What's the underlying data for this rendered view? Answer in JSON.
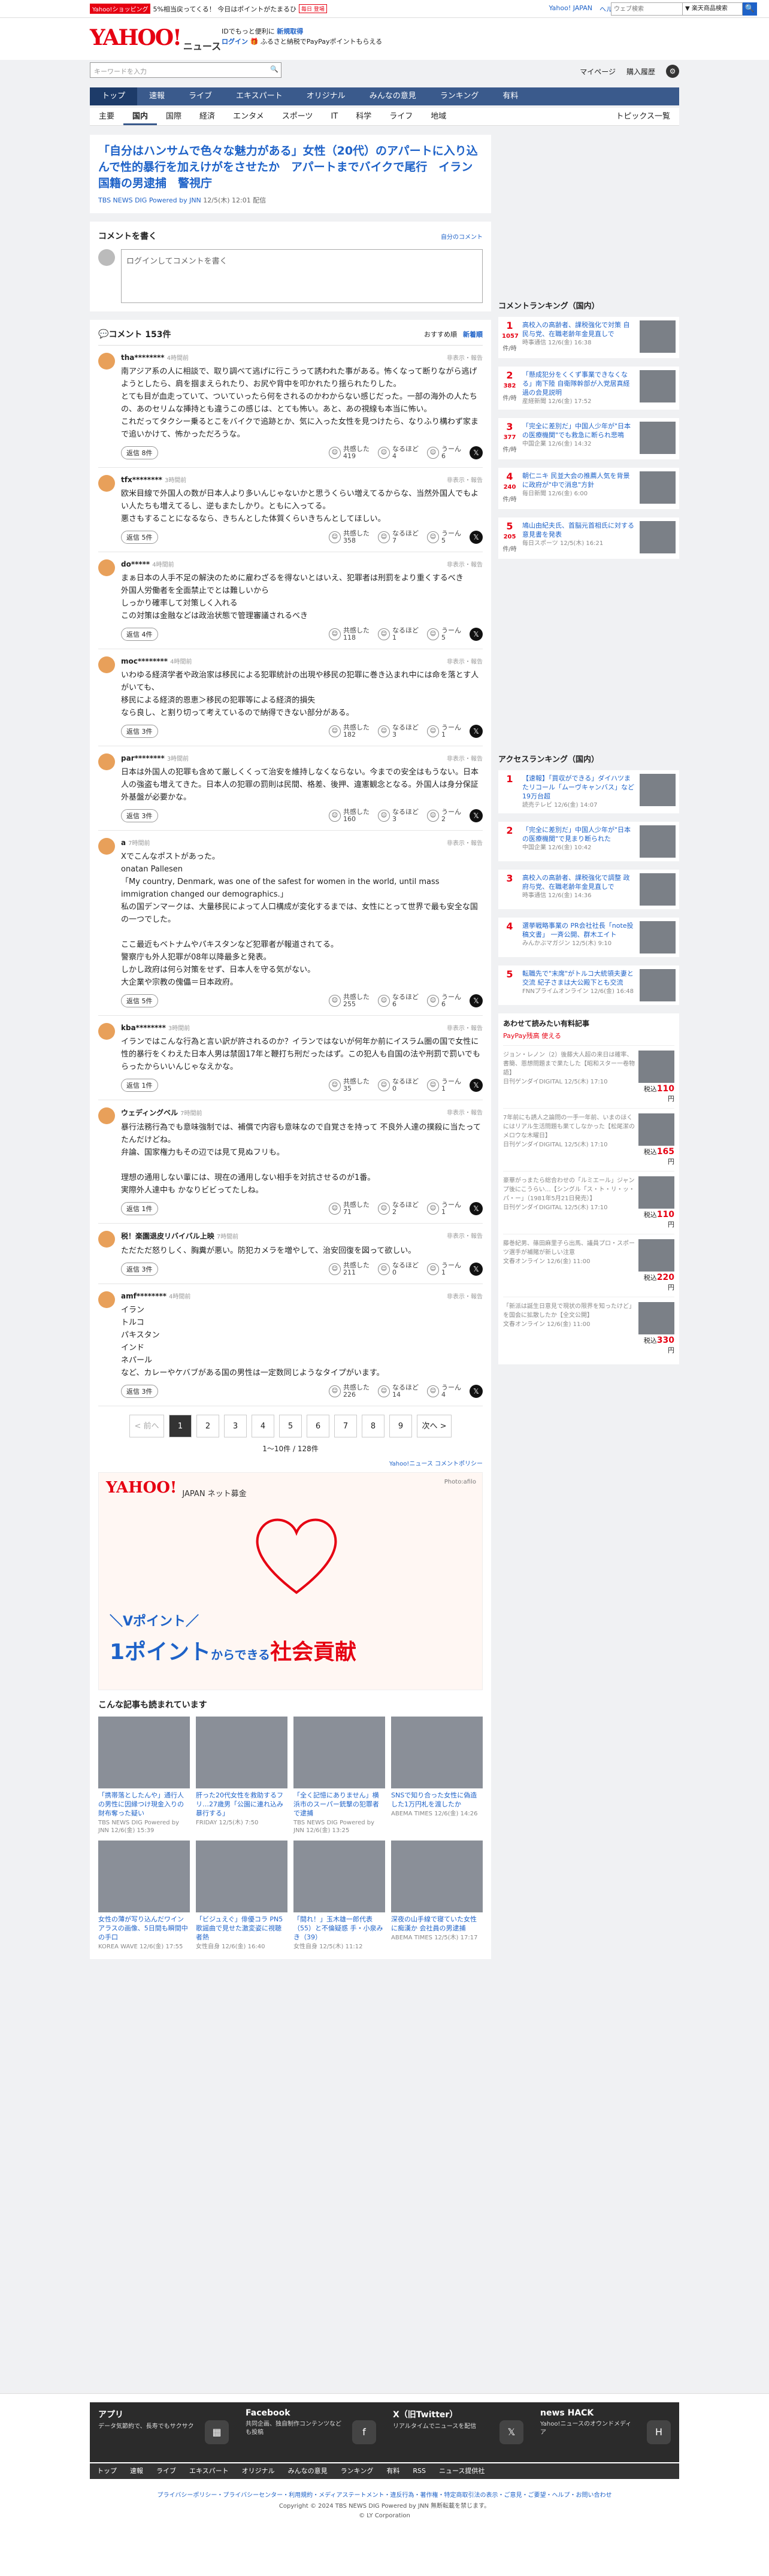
{
  "topbar": {
    "promo_tag": "Yahoo!ショッピング",
    "promo_text": "5%相当戻ってくる！ 今日はポイントがたまるひ",
    "promo_pill": "毎日 登場",
    "links": [
      "Yahoo! JAPAN",
      "ヘルプ"
    ],
    "search_placeholder": "ウェブ検索",
    "search_select": "▼ 楽天商品検索",
    "search_button": "🔍"
  },
  "header": {
    "logo": "YAHOO!",
    "logo_sub": "ニュース",
    "note1_prefix": "IDでもっと便利に",
    "note1_link": "新規取得",
    "note2_login": "ログイン",
    "note2_text": "ふるさと納税でPayPayポイントもらえる",
    "search_placeholder": "キーワードを入力",
    "right_links": [
      "マイページ",
      "購入履歴"
    ],
    "gear": "⚙"
  },
  "nav": {
    "main": [
      "トップ",
      "速報",
      "ライブ",
      "エキスパート",
      "オリジナル",
      "みんなの意見",
      "ランキング",
      "有料"
    ],
    "active": 0,
    "sub": [
      "主要",
      "国内",
      "国際",
      "経済",
      "エンタメ",
      "スポーツ",
      "IT",
      "科学",
      "ライフ",
      "地域"
    ],
    "sub_active": 1,
    "sub_right": "トピックス一覧"
  },
  "article": {
    "headline": "「自分はハンサムで色々な魅力がある」女性（20代）のアパートに入り込んで性的暴行を加えけがをさせたか　アパートまでバイクで尾行　イラン国籍の男逮捕　警視庁",
    "source": "TBS NEWS DIG Powered by JNN",
    "date": "12/5(木) 12:01 配信"
  },
  "comment_form": {
    "title": "コメントを書く",
    "right": "自分のコメント",
    "placeholder": "ログインしてコメントを書く"
  },
  "comments_head": {
    "title": "コメント 153件",
    "sort": [
      "おすすめ順",
      "新着順"
    ]
  },
  "comments": [
    {
      "user": "tha********",
      "time": "4時間前",
      "text": "南アジア系の人に相談で、取り調べて逃げに行こうって誘われた事がある。怖くなって断りながら逃げようとしたら、肩を掴まえられたり、お尻や背中を叩かれたり揺られたりした。\nとても目が血走っていて、ついていったら何をされるのかわからない感じだった。一部の海外の人たちの、あのセリムな挿持とも違うこの感じは、とても怖い。あと、あの視線も本当に怖い。\nこれだってタクシー乗るとこをバイクで追跡とか、気に入った女性を見つけたら、なりふり構わず家まで追いかけて、怖かっただろうな。",
      "reply": "返信 8件",
      "v1": "419",
      "v2": "4",
      "v3": "6"
    },
    {
      "user": "tfx********",
      "time": "3時間前",
      "text": "欧米目線で外国人の数が日本人より多いんじゃないかと思うくらい増えてるからな、当然外国人でもよい人たちも増えてるし、逆もまたしかり。ともに入ってる。\n悪さもすることになるなら、きちんとした体質くらいきちんとしてほしい。",
      "reply": "返信 5件",
      "v1": "358",
      "v2": "7",
      "v3": "5"
    },
    {
      "user": "do*****",
      "time": "4時間前",
      "text": "まぁ日本の人手不足の解決のために雇わざるを得ないとはいえ、犯罪者は刑罰をより重くするべき\n外国人労働者を全面禁止でとは難しいから\nしっかり確率して対策しく入れる\nこの対策は金融などは政治状態で管理審議されるべき",
      "reply": "返信 4件",
      "v1": "118",
      "v2": "1",
      "v3": "5"
    },
    {
      "user": "moc********",
      "time": "4時間前",
      "text": "いわゆる経済学者や政治家は移民による犯罪統計の出現や移民の犯罪に巻き込まれ中には命を落とす人がいても、\n移民による経済的恩恵＞移民の犯罪等による経済的損失\nなら良し、と割り切って考えているので納得できない部分がある。",
      "reply": "返信 3件",
      "v1": "182",
      "v2": "3",
      "v3": "1"
    },
    {
      "user": "par********",
      "time": "3時間前",
      "text": "日本は外国人の犯罪も含めて厳しくくって治安を維持しなくならない。今までの安全はもうない。日本人の強盗も増えてきた。日本人の犯罪の罰則は民間、格差、後押、違憲観念となる。外国人は身分保証外基盤が必要かな。",
      "reply": "返信 3件",
      "v1": "160",
      "v2": "3",
      "v3": "2"
    },
    {
      "user": "a",
      "time": "7時間前",
      "text": "Xでこんなポストがあった。\nonatan Pallesen\n「My country, Denmark, was one of the safest for women in the world, until mass immigration changed our demographics.」\n 私の国デンマークは、大量移民によって人口構成が変化するまでは、女性にとって世界で最も安全な国の一つでした。\n\nここ最近もベトナムやパキスタンなど犯罪者が報道されてる。\n警察庁も外人犯罪が08年以降最多と発表。\nしかし政府は何ら対策をせず、日本人を守る気がない。\n大企業や宗教の傀儡＝日本政府。",
      "reply": "返信 5件",
      "v1": "255",
      "v2": "6",
      "v3": "6"
    },
    {
      "user": "kba********",
      "time": "3時間前",
      "text": "イランではこんな行為と言い訳が許されるのか？イランではないが何年か前にイスラム圏の国で女性に性的暴行をくわえた日本人男は禁固17年と鞭打ち刑だったはず。この犯人も自国の法や刑罰で罰いでもらったからいいんじゃなえかな。",
      "reply": "返信 1件",
      "v1": "35",
      "v2": "0",
      "v3": "1"
    },
    {
      "user": "ウェディングベル",
      "time": "7時間前",
      "text": "暴行法務行為でも意味強制では、補償で内容も意味なので自覚さを持って 不良外人達の撲殺に当たってたんだけどね。\n弁論、国家権力もその辺では見て見ぬフリも。\n\n理想の通用しない輩には、現在の通用しない相手を対抗させるのが1番。\n実際外人達中も かなりビビってたしね。",
      "reply": "返信 1件",
      "v1": "71",
      "v2": "2",
      "v3": "1"
    },
    {
      "user": "税！楽園退皮リバイバル上映",
      "time": "7時間前",
      "text": "ただただ怒りしく、胸糞が悪い。防犯カメラを増やして、治安回復を図って欲しい。",
      "reply": "返信 3件",
      "v1": "211",
      "v2": "0",
      "v3": "1"
    },
    {
      "user": "amf********",
      "time": "4時間前",
      "text": "イラン\nトルコ\nパキスタン\nインド\nネパール\nなど、カレーやケバブがある国の男性は一定数同じようなタイプがいます。",
      "reply": "返信 3件",
      "v1": "226",
      "v2": "14",
      "v3": "4"
    }
  ],
  "vote_labels": {
    "a": "共感した",
    "b": "なるほど",
    "c": "うーん"
  },
  "report": "非表示・報告",
  "pager": {
    "prev": "< 前へ",
    "pages": [
      "1",
      "2",
      "3",
      "4",
      "5",
      "6",
      "7",
      "8",
      "9"
    ],
    "next": "次へ >",
    "info": "1〜10件 / 128件",
    "policy": "Yahoo!ニュース コメントポリシー"
  },
  "ad": {
    "logo": "YAHOO!",
    "logo_sub": "JAPAN ネット募金",
    "photo": "Photo:afilo",
    "line1": "＼Vポイント／",
    "line2a": "1ポイント",
    "line2b": "からできる",
    "line2c": "社会貢献"
  },
  "reco": {
    "title": "こんな記事も読まれています",
    "items": [
      {
        "t": "「携帯落としたんや」通行人の男性に因縁つけ現金入りの財布奪った疑い",
        "s": "TBS NEWS DIG Powered by JNN 12/6(金) 15:39"
      },
      {
        "t": "肝った20代女性を救助するフリ…27歳男「公園に連れ込み暴行する」",
        "s": "FRIDAY 12/5(木) 7:50"
      },
      {
        "t": "「全く記憶にありません」横浜市のスーパー銃撃の犯罪者で逮捕",
        "s": "TBS NEWS DIG Powered by JNN 12/6(金) 13:25"
      },
      {
        "t": "SNSで知り合った女性に偽造した1万円札を渡したか",
        "s": "ABEMA TIMES 12/6(金) 14:26"
      },
      {
        "t": "女性の薄が写り込んだワインアラスの画像、5日間も瞬間中の手口",
        "s": "KOREA WAVE 12/6(金) 17:55"
      },
      {
        "t": "「ビジュえぐ」俳優コラ PN5歌謡曲で見せた激変姿に視聴者熱",
        "s": "女性自身 12/6(金) 16:40"
      },
      {
        "t": "「間れ！」玉木雄一郎代表（55）と不倫疑惑 手・小泉みき（39）",
        "s": "女性自身 12/5(木) 11:12"
      },
      {
        "t": "深夜の山手線で寝ていた女性に痴漢か 会社員の男逮捕",
        "s": "ABEMA TIMES 12/5(木) 17:17"
      }
    ]
  },
  "side": {
    "ranking_title": "コメントランキング（国内）",
    "ranking": [
      {
        "n": "1",
        "c": "1057",
        "t": "高校入の高齢者、課税強化で対策 自民与党、在職老齢年金見直しで",
        "m": "時事通信 12/6(金) 16:38"
      },
      {
        "n": "2",
        "c": "382",
        "t": "「懸成犯分をくくず事業できなくなる」南下陸 自衛隊幹部が入党居真経過の会見説明",
        "m": "産経新聞 12/6(金) 17:52"
      },
      {
        "n": "3",
        "c": "377",
        "t": "「完全に差別だ」中国人少年が\"日本の医療機関\"でも救急に断られ悲鳴",
        "m": "中国企業 12/6(金) 14:32"
      },
      {
        "n": "4",
        "c": "240",
        "t": "朝仁ニキ 民並大会の推薦人気を背景に政府が\"中で消息\"方針",
        "m": "毎日新聞 12/6(金) 6:00"
      },
      {
        "n": "5",
        "c": "205",
        "t": "鳩山由紀夫氏、首脳元首相氏に対する意見書を発表",
        "m": "毎日スポーツ 12/5(木) 16:21"
      }
    ],
    "hot_label": "件/時",
    "access_title": "アクセスランキング（国内）",
    "access": [
      {
        "n": "1",
        "t": "【速報】「買収ができる」ダイハツまたリコール「ムーヴキャンバス」など19万台超",
        "m": "読売テレビ 12/6(金) 14:07"
      },
      {
        "n": "2",
        "t": "「完全に差別だ」中国人少年が\"日本の医療機関\"で見まり断られた",
        "m": "中国企業 12/6(金) 10:42"
      },
      {
        "n": "3",
        "t": "高校入の高齢者、課税強化で調整 政府与党、在職老齢年金見直しで",
        "m": "時事通信 12/6(金) 14:36"
      },
      {
        "n": "4",
        "t": "選挙戦略事業の PR会社社長「note投稿文書」 一斉公開、群木エイト",
        "m": "みんかぶマガジン 12/5(木) 9:10"
      },
      {
        "n": "5",
        "t": "転職先で\"末席\"がトルコ大統領夫妻と交流 紀子さまは大公殿下とも交流",
        "m": "FNNプライムオンライン 12/6(金) 16:48"
      }
    ],
    "shop_title": "あわせて読みたい有料記事",
    "shop_brand": "PayPay残高 使える",
    "shop": [
      {
        "t": "ジョン・レノン（2）後藤大人超の来日は確率、書簡、恩想問題まで果たした【昭和スター一卷物語】",
        "s": "日刊ゲンダイDIGITAL 12/5(木) 17:10",
        "p": "110"
      },
      {
        "t": "7年前にも誘人之論問の一手一年前、いまのほくにはリアル生活問題も果てしなかった【松尾潔のメロウな木曜日】",
        "s": "日刊ゲンダイDIGITAL 12/5(木) 17:10",
        "p": "165"
      },
      {
        "t": "豪華がっまたら総合わせの「ルミエール」ジャンプ後にこうらい…【シングル「ス・ト・リ・ッ・パ・ー」（1981年5月21日発売）】",
        "s": "日刊ゲンダイDIGITAL 12/5(木) 17:10",
        "p": "110"
      },
      {
        "t": "藤巻紀男、篠田麻里子ら出馬、議員プロ・スポーツ選手が補賭が新しい注意",
        "s": "文春オンライン 12/6(金) 11:00",
        "p": "220"
      },
      {
        "t": "「新派は誕生日意見で現状の限界を知ったけど」を国会に拡散したか【全文公開】",
        "s": "文春オンライン 12/6(金) 11:00",
        "p": "330"
      }
    ],
    "yen_prefix": "税込",
    "yen_suffix": "円"
  },
  "footer": {
    "cols": [
      {
        "h": "アプリ",
        "d": "データ気節約で、長寿でもサクサク"
      },
      {
        "h": "Facebook",
        "d": "共同企画、独自制作コンテンツなども投稿"
      },
      {
        "h": "X（旧Twitter）",
        "d": "リアルタイムでニュースを配信"
      },
      {
        "h": "news HACK",
        "d": "Yahoo!ニュースのオウンドメディア"
      }
    ],
    "nav": [
      "トップ",
      "速報",
      "ライブ",
      "エキスパート",
      "オリジナル",
      "みんなの意見",
      "ランキング",
      "有料",
      "RSS",
      "ニュース提供社"
    ],
    "links": "プライバシーポリシー・プライバシーセンター・利用規約・メディアステートメント・違反行為・著作権・特定商取引法の表示・ご意見・ご要望・ヘルプ・お問い合わせ",
    "copy1": "Copyright © 2024 TBS NEWS DIG Powered by JNN 無断転載を禁じます。",
    "copy2": "© LY Corporation"
  }
}
